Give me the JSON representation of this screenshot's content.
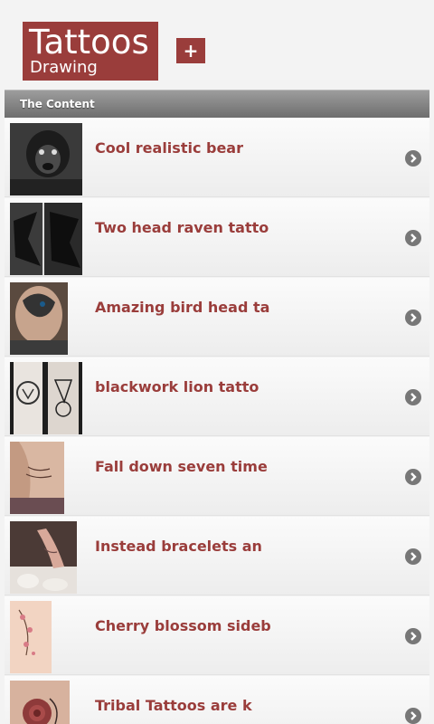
{
  "header": {
    "logo_title": "Tattoos",
    "logo_subtitle": "Drawing",
    "add_label": "+"
  },
  "section": {
    "title": "The Content"
  },
  "items": [
    {
      "title": "Cool realistic bear",
      "thumb": "bear-tattoo-image"
    },
    {
      "title": "Two head raven tatto",
      "thumb": "raven-tattoo-image"
    },
    {
      "title": "Amazing bird head ta",
      "thumb": "bird-head-tattoo-image"
    },
    {
      "title": "blackwork lion tatto",
      "thumb": "lion-tattoo-image"
    },
    {
      "title": "Fall down seven time",
      "thumb": "side-script-tattoo-image"
    },
    {
      "title": "Instead bracelets an",
      "thumb": "hand-bracelet-tattoo-image"
    },
    {
      "title": "Cherry blossom sideb",
      "thumb": "cherry-blossom-tattoo-image"
    },
    {
      "title": "Tribal Tattoos are k",
      "thumb": "rose-tattoo-image"
    }
  ],
  "colors": {
    "accent": "#9a3d3b",
    "section_bar": "#7d7d7d",
    "chevron": "#777777"
  },
  "icons": {
    "row_arrow": "chevron-right-circle-icon"
  }
}
